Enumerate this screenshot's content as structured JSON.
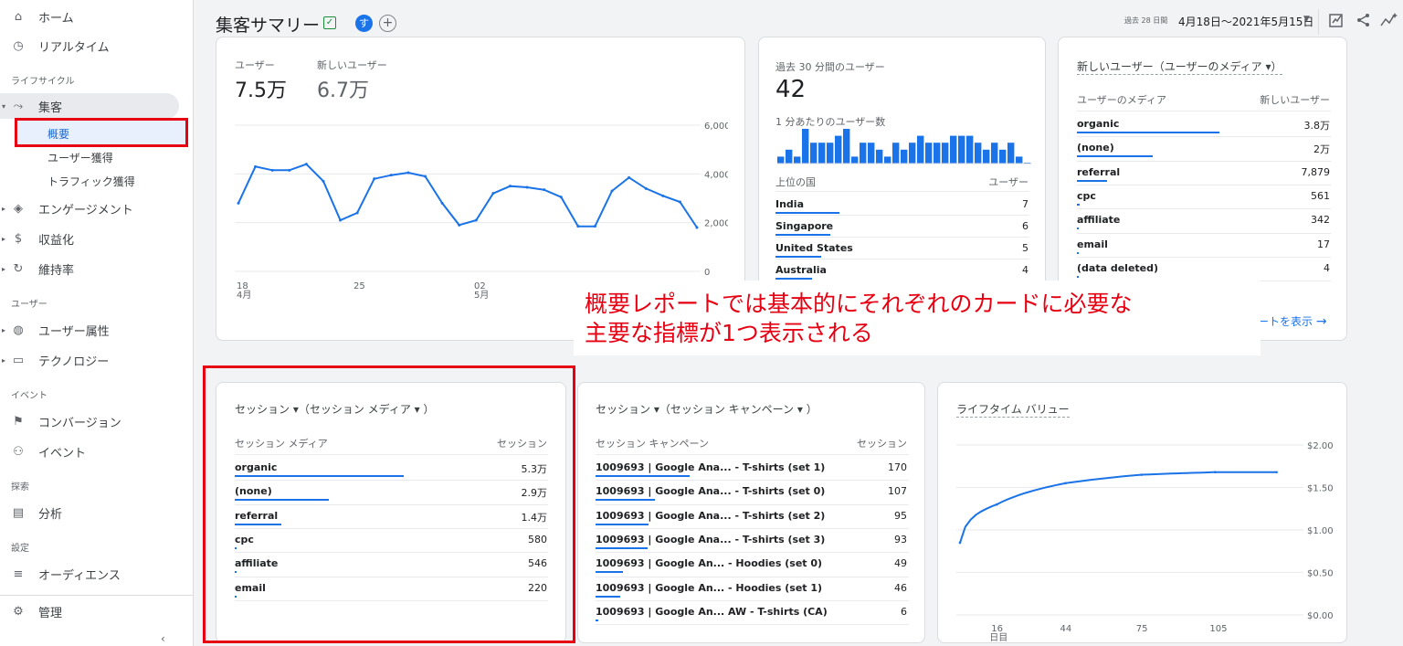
{
  "sidebar": {
    "home": "ホーム",
    "realtime": "リアルタイム",
    "section_lifecycle": "ライフサイクル",
    "acquisition": "集客",
    "acq_overview": "概要",
    "acq_user": "ユーザー獲得",
    "acq_traffic": "トラフィック獲得",
    "engagement": "エンゲージメント",
    "monetization": "収益化",
    "retention": "維持率",
    "section_user": "ユーザー",
    "demographics": "ユーザー属性",
    "tech": "テクノロジー",
    "section_event": "イベント",
    "conversion": "コンバージョン",
    "event": "イベント",
    "section_explore": "探索",
    "analysis": "分析",
    "section_config": "設定",
    "audience": "オーディエンス",
    "admin": "管理"
  },
  "header": {
    "title": "集客サマリー",
    "avatar_letter": "す",
    "range_label": "過去 28 日間",
    "range_value": "4月18日～2021年5月15日"
  },
  "overview_card": {
    "users_label": "ユーザー",
    "users_value": "7.5万",
    "new_users_label": "新しいユーザー",
    "new_users_value": "6.7万",
    "y_ticks": [
      "6,000",
      "4,000",
      "2,000",
      "0"
    ],
    "x_ticks": [
      {
        "d": "18",
        "m": "4月"
      },
      {
        "d": "25",
        "m": ""
      },
      {
        "d": "02",
        "m": "5月"
      }
    ]
  },
  "realtime_card": {
    "title": "過去 30 分間のユーザー",
    "value": "42",
    "per_minute": "1 分あたりのユーザー数",
    "col_country": "上位の国",
    "col_users": "ユーザー",
    "rows": [
      {
        "label": "India",
        "value": "7"
      },
      {
        "label": "Singapore",
        "value": "6"
      },
      {
        "label": "United States",
        "value": "5"
      },
      {
        "label": "Australia",
        "value": "4"
      }
    ]
  },
  "new_users_card": {
    "title": "新しいユーザー（ユーザーのメディア ▾）",
    "col_medium": "ユーザーのメディア",
    "col_new": "新しいユーザー",
    "rows": [
      {
        "label": "organic",
        "value": "3.8万"
      },
      {
        "label": "(none)",
        "value": "2万"
      },
      {
        "label": "referral",
        "value": "7,879"
      },
      {
        "label": "cpc",
        "value": "561"
      },
      {
        "label": "affiliate",
        "value": "342"
      },
      {
        "label": "email",
        "value": "17"
      },
      {
        "label": "(data deleted)",
        "value": "4"
      }
    ],
    "link": "ートを表示"
  },
  "session_medium_card": {
    "title": "セッション ▾（セッション メディア ▾ ）",
    "col_medium": "セッション メディア",
    "col_sessions": "セッション",
    "rows": [
      {
        "label": "organic",
        "value": "5.3万"
      },
      {
        "label": "(none)",
        "value": "2.9万"
      },
      {
        "label": "referral",
        "value": "1.4万"
      },
      {
        "label": "cpc",
        "value": "580"
      },
      {
        "label": "affiliate",
        "value": "546"
      },
      {
        "label": "email",
        "value": "220"
      }
    ]
  },
  "session_campaign_card": {
    "title": "セッション ▾（セッション キャンペーン ▾ ）",
    "col_campaign": "セッション キャンペーン",
    "col_sessions": "セッション",
    "rows": [
      {
        "label": "1009693 | Google Ana... - T-shirts (set 1)",
        "value": "170"
      },
      {
        "label": "1009693 | Google Ana... - T-shirts (set 0)",
        "value": "107"
      },
      {
        "label": "1009693 | Google Ana... - T-shirts (set 2)",
        "value": "95"
      },
      {
        "label": "1009693 | Google Ana... - T-shirts (set 3)",
        "value": "93"
      },
      {
        "label": "1009693 | Google An... - Hoodies (set 0)",
        "value": "49"
      },
      {
        "label": "1009693 | Google An... - Hoodies (set 1)",
        "value": "46"
      },
      {
        "label": "1009693 | Google An... AW - T-shirts (CA)",
        "value": "6"
      }
    ]
  },
  "ltv_card": {
    "title": "ライフタイム バリュー",
    "y_ticks": [
      "$2.00",
      "$1.50",
      "$1.00",
      "$0.50",
      "$0.00"
    ],
    "x_ticks": [
      "16",
      "44",
      "75",
      "105"
    ],
    "x_unit": "日目"
  },
  "annotation": {
    "line1": "概要レポートでは基本的にそれぞれのカードに必要な",
    "line2": "主要な指標が1つ表示される"
  },
  "chart_data": [
    {
      "type": "line",
      "series": [
        {
          "name": "ユーザー",
          "values": [
            2800,
            4300,
            4150,
            4150,
            4400,
            3700,
            2100,
            2400,
            3800,
            3950,
            4050,
            3900,
            2800,
            1900,
            2100,
            3200,
            3500,
            3450,
            3350,
            3050,
            1850,
            1850,
            3300,
            3850,
            3400,
            3100,
            2850,
            1800
          ]
        }
      ],
      "ylim": [
        0,
        6000
      ]
    },
    {
      "type": "bar",
      "values": [
        1,
        2,
        1,
        5,
        3,
        3,
        3,
        4,
        5,
        1,
        3,
        3,
        2,
        1,
        3,
        2,
        3,
        4,
        3,
        3,
        3,
        4,
        4,
        4,
        3,
        2,
        3,
        2,
        3,
        1,
        0
      ]
    },
    {
      "type": "line",
      "x": [
        1,
        16,
        44,
        75,
        105,
        130
      ],
      "series": [
        {
          "name": "",
          "values": [
            0.85,
            1.3,
            1.55,
            1.65,
            1.68,
            1.68
          ]
        }
      ],
      "ylim": [
        0,
        2
      ]
    }
  ]
}
